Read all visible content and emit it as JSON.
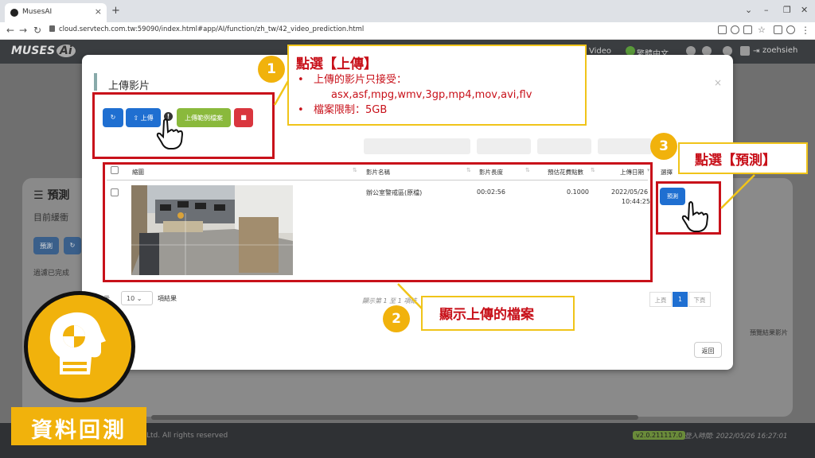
{
  "browser": {
    "tab_title": "MusesAI",
    "new_tab": "+",
    "url": "cloud.servtech.com.tw:59090/index.html#app/AI/function/zh_tw/42_video_prediction.html"
  },
  "app_header": {
    "logo_text": "MUSES",
    "logo_ai": "Ai",
    "nav_video": "Video",
    "nav_language": "繁體中文",
    "username": "zoehsieh"
  },
  "background_page": {
    "title": "預測",
    "subtitle": "目前緩衝",
    "predict_button": "預測",
    "filter_text": "過濾已完成",
    "result_column": "預覽結果影片",
    "copyright": "Ltd. All rights reserved",
    "version": "v2.0.211117.0",
    "login_time": "登入時間: 2022/05/26 16:27:01"
  },
  "modal": {
    "title": "上傳影片",
    "close": "×",
    "upload_button": "上傳",
    "sample_button": "上傳範例檔案",
    "info_icon": "!",
    "columns": {
      "thumbnail": "縮圖",
      "name": "影片名稱",
      "length": "影片長度",
      "cost": "預估花費點數",
      "date": "上傳日期",
      "select": "選擇"
    },
    "rows": [
      {
        "name": "辦公室警戒區(原檔)",
        "length": "00:02:56",
        "cost": "0.1000",
        "date": "2022/05/26",
        "time": "10:44:25",
        "action": "預測"
      }
    ],
    "show_prefix": "示",
    "page_size": "10",
    "show_suffix": "項結果",
    "info_text": "顯示第 1 至 1 項結",
    "pagination": {
      "prev": "上頁",
      "current": "1",
      "next": "下頁"
    },
    "back_button": "返回"
  },
  "annotations": {
    "step1_number": "1",
    "step1_title": "點選【上傳】",
    "step1_bullets": [
      "上傳的影片只接受：",
      "asx,asf,mpg,wmv,3gp,mp4,mov,avi,flv",
      "檔案限制：5GB"
    ],
    "step2_number": "2",
    "step2_text": "顯示上傳的檔案",
    "step3_number": "3",
    "step3_text": "點選【預測】"
  },
  "badge": {
    "label": "資料回測"
  },
  "colors": {
    "accent_blue": "#1f6fd1",
    "annotation_red": "#c8111a",
    "annotation_yellow": "#f1b20c",
    "sample_green": "#8ab93c",
    "delete_red": "#d9363e"
  }
}
